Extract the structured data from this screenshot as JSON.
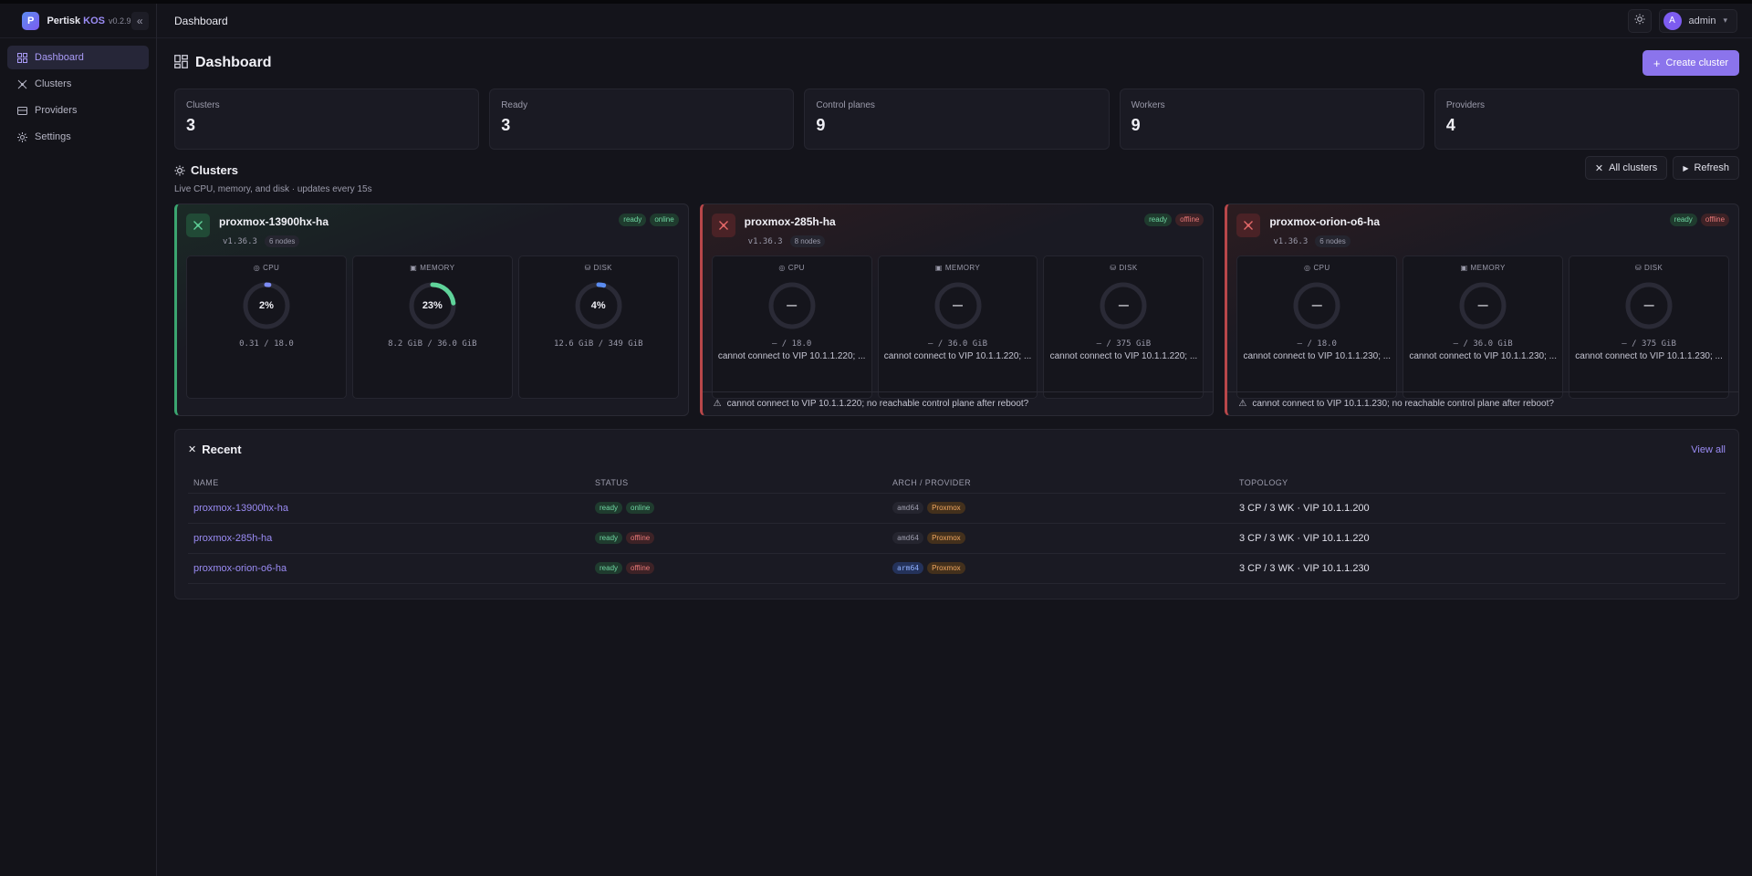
{
  "brand": {
    "logo": "P",
    "name": "Pertisk",
    "accent": "KOS",
    "version": "v0.2.9"
  },
  "sidebar": {
    "items": [
      {
        "label": "Dashboard",
        "icon": "dashboard-icon",
        "active": true
      },
      {
        "label": "Clusters",
        "icon": "clusters-icon"
      },
      {
        "label": "Providers",
        "icon": "providers-icon"
      },
      {
        "label": "Settings",
        "icon": "settings-icon"
      }
    ]
  },
  "topbar": {
    "title": "Dashboard",
    "user_initial": "A",
    "user_name": "admin"
  },
  "page": {
    "title": "Dashboard",
    "create_button": "Create cluster"
  },
  "stats": [
    {
      "label": "Clusters",
      "value": "3"
    },
    {
      "label": "Ready",
      "value": "3"
    },
    {
      "label": "Control planes",
      "value": "9"
    },
    {
      "label": "Workers",
      "value": "9"
    },
    {
      "label": "Providers",
      "value": "4"
    }
  ],
  "clusters_section": {
    "title": "Clusters",
    "subtitle": "Live CPU, memory, and disk · updates every 15s",
    "all_button": "All clusters",
    "refresh_button": "Refresh"
  },
  "clusters": [
    {
      "name": "proxmox-13900hx-ha",
      "version": "v1.36.3",
      "nodes": "6 nodes",
      "status": "ready",
      "connection": "online",
      "metrics": [
        {
          "label": "CPU",
          "value": "2%",
          "percent": 2,
          "used": "0.31 / 18.0",
          "error": ""
        },
        {
          "label": "MEMORY",
          "value": "23%",
          "percent": 23,
          "used": "8.2 GiB / 36.0 GiB",
          "error": ""
        },
        {
          "label": "DISK",
          "value": "4%",
          "percent": 4,
          "used": "12.6 GiB / 349 GiB",
          "error": ""
        }
      ],
      "warning": ""
    },
    {
      "name": "proxmox-285h-ha",
      "version": "v1.36.3",
      "nodes": "8 nodes",
      "status": "ready",
      "connection": "offline",
      "metrics": [
        {
          "label": "CPU",
          "value": "—",
          "percent": 0,
          "used": "— / 18.0",
          "error": "cannot connect to VIP 10.1.1.220; ..."
        },
        {
          "label": "MEMORY",
          "value": "—",
          "percent": 0,
          "used": "— / 36.0 GiB",
          "error": "cannot connect to VIP 10.1.1.220; ..."
        },
        {
          "label": "DISK",
          "value": "—",
          "percent": 0,
          "used": "— / 375 GiB",
          "error": "cannot connect to VIP 10.1.1.220; ..."
        }
      ],
      "warning": "cannot connect to VIP 10.1.1.220; no reachable control plane after reboot?"
    },
    {
      "name": "proxmox-orion-o6-ha",
      "version": "v1.36.3",
      "nodes": "6 nodes",
      "status": "ready",
      "connection": "offline",
      "metrics": [
        {
          "label": "CPU",
          "value": "—",
          "percent": 0,
          "used": "— / 18.0",
          "error": "cannot connect to VIP 10.1.1.230; ..."
        },
        {
          "label": "MEMORY",
          "value": "—",
          "percent": 0,
          "used": "— / 36.0 GiB",
          "error": "cannot connect to VIP 10.1.1.230; ..."
        },
        {
          "label": "DISK",
          "value": "—",
          "percent": 0,
          "used": "— / 375 GiB",
          "error": "cannot connect to VIP 10.1.1.230; ..."
        }
      ],
      "warning": "cannot connect to VIP 10.1.1.230; no reachable control plane after reboot?"
    }
  ],
  "recent": {
    "title": "Recent",
    "view_all": "View all",
    "columns": [
      "NAME",
      "STATUS",
      "ARCH / PROVIDER",
      "TOPOLOGY"
    ],
    "rows": [
      {
        "name": "proxmox-13900hx-ha",
        "status": "ready",
        "connection": "online",
        "arch": "amd64",
        "provider": "Proxmox",
        "topology": "3 CP / 3 WK · VIP 10.1.1.200"
      },
      {
        "name": "proxmox-285h-ha",
        "status": "ready",
        "connection": "offline",
        "arch": "amd64",
        "provider": "Proxmox",
        "topology": "3 CP / 3 WK · VIP 10.1.1.220"
      },
      {
        "name": "proxmox-orion-o6-ha",
        "status": "ready",
        "connection": "offline",
        "arch": "arm64",
        "provider": "Proxmox",
        "topology": "3 CP / 3 WK · VIP 10.1.1.230"
      }
    ]
  },
  "colors": {
    "accent": "#8b74ec",
    "cpu": "#7d8cf5",
    "memory": "#5fd39a",
    "disk": "#5b8cf0",
    "online": "#6fd6a2",
    "offline": "#e87878"
  }
}
